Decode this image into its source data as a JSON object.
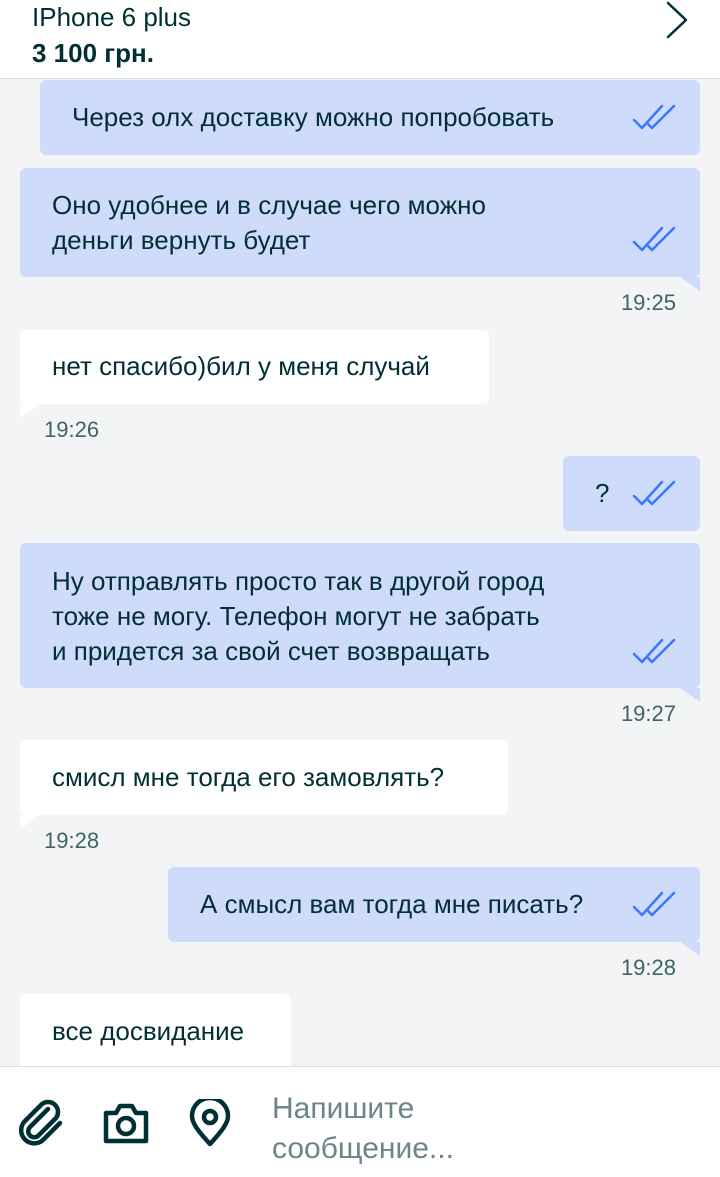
{
  "header": {
    "title": "IPhone 6 plus",
    "price": "3 100 грн."
  },
  "messages": [
    {
      "dir": "out",
      "text": "Через олх доставку можно попробовать",
      "read": true
    },
    {
      "dir": "out",
      "text": "Оно удобнее и в случае чего можно\nденьги вернуть будет",
      "read": true,
      "time": "19:25"
    },
    {
      "dir": "in",
      "text": "нет спасибо)бил у меня случай",
      "time": "19:26"
    },
    {
      "dir": "out",
      "text": "?",
      "read": true
    },
    {
      "dir": "out",
      "text": "Ну отправлять просто так в другой город\nтоже не могу. Телефон могут не забрать\nи придется за свой счет возвращать",
      "read": true,
      "time": "19:27"
    },
    {
      "dir": "in",
      "text": "смисл мне тогда его замовлять?",
      "time": "19:28"
    },
    {
      "dir": "out",
      "text": "А смысл вам тогда мне писать?",
      "read": true,
      "time": "19:28"
    },
    {
      "dir": "in",
      "text": "все досвидание"
    }
  ],
  "composer": {
    "placeholder": "Напишите\nсообщение...",
    "icons": [
      "paperclip-icon",
      "camera-icon",
      "location-pin-icon"
    ]
  },
  "colors": {
    "outgoing_bubble": "#cfdbfa",
    "incoming_bubble": "#ffffff",
    "background": "#f2f4f5",
    "read_ticks": "#3a77ff",
    "text": "#002f34"
  }
}
